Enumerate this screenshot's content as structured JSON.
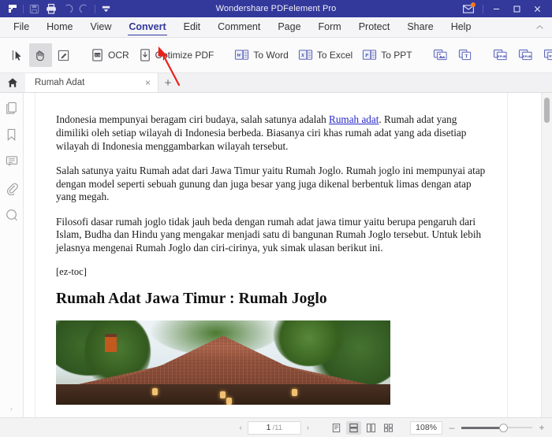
{
  "window": {
    "title": "Wondershare PDFelement Pro",
    "quick_access": [
      {
        "name": "app-logo",
        "label": "PDFelement"
      },
      {
        "name": "save-icon",
        "label": "Save"
      },
      {
        "name": "print-icon",
        "label": "Print"
      },
      {
        "name": "undo-icon",
        "label": "Undo"
      },
      {
        "name": "redo-icon",
        "label": "Redo"
      },
      {
        "name": "customize-caret-icon",
        "label": "Customize Quick Access Toolbar"
      }
    ],
    "controls": {
      "mail": "Messages",
      "minimize": "—",
      "maximize": "❐",
      "close": "✕"
    },
    "accent_color": "#33389b",
    "notification_color": "#ff7a18"
  },
  "menubar": {
    "items": [
      {
        "label": "File",
        "active": false
      },
      {
        "label": "Home",
        "active": false
      },
      {
        "label": "View",
        "active": false
      },
      {
        "label": "Convert",
        "active": true
      },
      {
        "label": "Edit",
        "active": false
      },
      {
        "label": "Comment",
        "active": false
      },
      {
        "label": "Page",
        "active": false
      },
      {
        "label": "Form",
        "active": false
      },
      {
        "label": "Protect",
        "active": false
      },
      {
        "label": "Share",
        "active": false
      },
      {
        "label": "Help",
        "active": false
      }
    ],
    "collapse_label": "Collapse Ribbon"
  },
  "ribbon": {
    "tools": [
      {
        "label": "",
        "icon": "select-cursor-icon",
        "selected": false
      },
      {
        "label": "",
        "icon": "hand-tool-icon",
        "selected": true
      },
      {
        "label": "",
        "icon": "edit-text-icon",
        "selected": false
      },
      {
        "label": "OCR",
        "icon": "ocr-icon",
        "selected": false
      },
      {
        "label": "Optimize PDF",
        "icon": "optimize-pdf-icon",
        "selected": false
      },
      {
        "label": "To Word",
        "icon": "to-word-icon",
        "selected": false
      },
      {
        "label": "To Excel",
        "icon": "to-excel-icon",
        "selected": false
      },
      {
        "label": "To PPT",
        "icon": "to-ppt-icon",
        "selected": false
      },
      {
        "label": "",
        "icon": "to-image-icon",
        "selected": false
      },
      {
        "label": "",
        "icon": "to-text-icon",
        "selected": false
      },
      {
        "label": "",
        "icon": "to-epub-icon",
        "selected": false
      },
      {
        "label": "",
        "icon": "to-html-icon",
        "selected": false
      },
      {
        "label": "",
        "icon": "to-rtf-icon",
        "selected": false
      },
      {
        "label": "",
        "icon": "to-pdfa-icon",
        "selected": false
      }
    ],
    "format_badges": [
      "EPUB",
      "EPUB",
      "RTF",
      "PDF"
    ]
  },
  "tabbar": {
    "home_label": "Home",
    "tabs": [
      {
        "label": "Rumah Adat",
        "close": "×",
        "active": true
      }
    ],
    "add_label": "+"
  },
  "sidebar": {
    "items": [
      {
        "name": "thumbnails-icon",
        "label": "Thumbnails"
      },
      {
        "name": "bookmark-icon",
        "label": "Bookmarks"
      },
      {
        "name": "comments-icon",
        "label": "Comments"
      },
      {
        "name": "attachments-icon",
        "label": "Attachments"
      },
      {
        "name": "search-icon",
        "label": "Search"
      }
    ],
    "expand_handle": "›"
  },
  "document": {
    "paragraphs": [
      {
        "before_link": "Indonesia mempunyai beragam ciri budaya, salah satunya adalah ",
        "link": "Rumah adat",
        "after_link": ". Rumah adat yang dimiliki oleh setiap wilayah di Indonesia berbeda. Biasanya ciri khas rumah adat yang ada disetiap wilayah di Indonesia menggambarkan wilayah tersebut."
      }
    ],
    "paragraph2": "Salah satunya yaitu Rumah adat dari Jawa Timur yaitu Rumah Joglo. Rumah joglo ini mempunyai atap dengan model seperti sebuah gunung dan juga besar yang juga dikenal berbentuk limas dengan atap yang megah.",
    "paragraph3": "Filosofi dasar rumah joglo tidak jauh beda dengan rumah adat jawa timur yaitu berupa pengaruh dari Islam, Budha dan Hindu yang mengakar menjadi satu di bangunan Rumah Joglo tersebut. Untuk lebih jelasnya mengenai Rumah Joglo dan ciri-cirinya, yuk simak ulasan berikut ini.",
    "shortcode": "[ez-toc]",
    "heading": "Rumah Adat Jawa Timur : Rumah Joglo",
    "image_alt": "Rumah Joglo traditional Javanese house with tiled roof among palm trees"
  },
  "statusbar": {
    "page_current": "1",
    "page_total": "/11",
    "prev_label": "‹",
    "next_label": "›",
    "view_modes": [
      {
        "name": "single-page-view-icon",
        "label": "Single Page",
        "active": false
      },
      {
        "name": "continuous-scroll-view-icon",
        "label": "Continuous",
        "active": true
      },
      {
        "name": "facing-pages-view-icon",
        "label": "Facing Pages",
        "active": false
      },
      {
        "name": "thumbnail-grid-view-icon",
        "label": "Grid",
        "active": false
      }
    ],
    "zoom_value": "108%",
    "zoom_out": "–",
    "zoom_in": "+"
  },
  "annotation": {
    "arrow_color": "#e8211c",
    "points_to": "Optimize PDF"
  }
}
